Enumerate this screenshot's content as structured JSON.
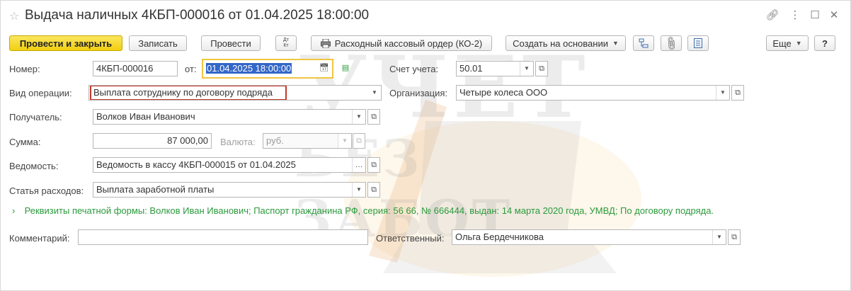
{
  "window": {
    "title": "Выдача наличных 4КБП-000016 от 01.04.2025 18:00:00"
  },
  "toolbar": {
    "post_close": "Провести и закрыть",
    "save": "Записать",
    "post": "Провести",
    "dtkt_top": "Дт",
    "dtkt_bottom": "Кт",
    "cash_order": "Расходный кассовый ордер (КО-2)",
    "create_based": "Создать на основании",
    "more": "Еще",
    "help": "?"
  },
  "watermark": {
    "line1": "УЧЕТ",
    "line2": "БЕЗ ЗАБОТ"
  },
  "form": {
    "number_label": "Номер:",
    "number_value": "4КБП-000016",
    "from_label": "от:",
    "date_value": "01.04.2025 18:00:00",
    "account_label": "Счет учета:",
    "account_value": "50.01",
    "operation_label": "Вид операции:",
    "operation_value": "Выплата сотруднику по договору подряда",
    "org_label": "Организация:",
    "org_value": "Четыре колеса ООО",
    "recipient_label": "Получатель:",
    "recipient_value": "Волков Иван Иванович",
    "sum_label": "Сумма:",
    "sum_value": "87 000,00",
    "currency_label": "Валюта:",
    "currency_value": "руб.",
    "statement_label": "Ведомость:",
    "statement_value": "Ведомость в кассу 4КБП-000015 от 01.04.2025",
    "expense_label": "Статья расходов:",
    "expense_value": "Выплата заработной платы",
    "print_requisites": "Реквизиты печатной формы: Волков Иван Иванович; Паспорт гражданина РФ, серия: 56 66, № 666444, выдан: 14 марта 2020 года, УМВД; По договору подряда.",
    "comment_label": "Комментарий:",
    "comment_value": "",
    "responsible_label": "Ответственный:",
    "responsible_value": "Ольга Бердечникова"
  },
  "colors": {
    "primary_button": "#f5d823",
    "requisites_link": "#2b9a3c",
    "date_selection": "#3367c8",
    "operation_highlight": "#c0392b"
  }
}
